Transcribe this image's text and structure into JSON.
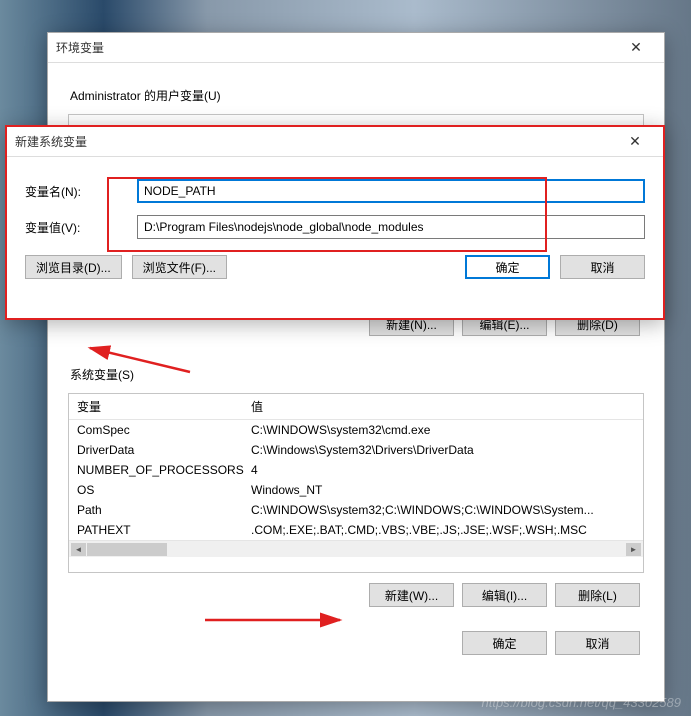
{
  "env_dialog": {
    "title": "环境变量",
    "user_vars_label": "Administrator 的用户变量(U)",
    "system_vars_label": "系统变量(S)",
    "columns": {
      "var": "变量",
      "val": "值"
    },
    "user_buttons": {
      "new": "新建(N)...",
      "edit": "编辑(E)...",
      "del": "删除(D)"
    },
    "sys_buttons": {
      "new": "新建(W)...",
      "edit": "编辑(I)...",
      "del": "删除(L)"
    },
    "bottom": {
      "ok": "确定",
      "cancel": "取消"
    },
    "sys_rows": [
      {
        "var": "ComSpec",
        "val": "C:\\WINDOWS\\system32\\cmd.exe"
      },
      {
        "var": "DriverData",
        "val": "C:\\Windows\\System32\\Drivers\\DriverData"
      },
      {
        "var": "NUMBER_OF_PROCESSORS",
        "val": "4"
      },
      {
        "var": "OS",
        "val": "Windows_NT"
      },
      {
        "var": "Path",
        "val": "C:\\WINDOWS\\system32;C:\\WINDOWS;C:\\WINDOWS\\System..."
      },
      {
        "var": "PATHEXT",
        "val": ".COM;.EXE;.BAT;.CMD;.VBS;.VBE;.JS;.JSE;.WSF;.WSH;.MSC"
      }
    ]
  },
  "new_dialog": {
    "title": "新建系统变量",
    "name_label": "变量名(N):",
    "value_label": "变量值(V):",
    "name_value": "NODE_PATH",
    "value_value": "D:\\Program Files\\nodejs\\node_global\\node_modules",
    "browse_dir": "浏览目录(D)...",
    "browse_file": "浏览文件(F)...",
    "ok": "确定",
    "cancel": "取消"
  },
  "watermark": "https://blog.csdn.net/qq_43302589"
}
